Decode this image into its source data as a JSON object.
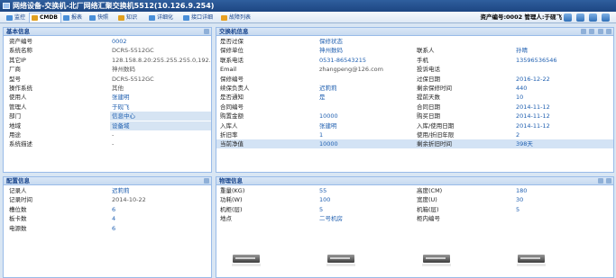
{
  "window": {
    "title": "网络设备-交换机-北厂网络汇聚交换机5512(10.126.9.254)"
  },
  "toolbar": {
    "tabs": [
      {
        "label": "监控",
        "color": "#4a8fd8",
        "active": false
      },
      {
        "label": "CMDB",
        "color": "#e0a020",
        "active": true
      },
      {
        "label": "报表",
        "color": "#4a8fd8",
        "active": false
      },
      {
        "label": "快照",
        "color": "#4a8fd8",
        "active": false
      },
      {
        "label": "知识",
        "color": "#e0a020",
        "active": false
      },
      {
        "label": "详细化",
        "color": "#4a8fd8",
        "active": false
      },
      {
        "label": "接口详细",
        "color": "#4a8fd8",
        "active": false
      },
      {
        "label": "故障列表",
        "color": "#e8a020",
        "active": false
      }
    ],
    "asset_info": "资产编号:0002  管理人:于砚飞",
    "tool_icons": [
      "refresh-icon",
      "home-icon",
      "print-icon",
      "export-icon"
    ]
  },
  "basic_info": {
    "title": "基本信息",
    "rows": [
      {
        "label": "资产编号",
        "value": "0002",
        "style": "link"
      },
      {
        "label": "系统名称",
        "value": "DCRS-5512GC",
        "style": ""
      },
      {
        "label": "其它IP",
        "value": "128.158.8.20:255.255.255.0,192.168.2...",
        "style": ""
      },
      {
        "label": "厂商",
        "value": "神州数码",
        "style": ""
      },
      {
        "label": "型号",
        "value": "DCRS-5512GC",
        "style": ""
      },
      {
        "label": "操作系统",
        "value": "其他",
        "style": ""
      },
      {
        "label": "使用人",
        "value": "张建明",
        "style": "link"
      },
      {
        "label": "管理人",
        "value": "于砚飞",
        "style": "link"
      },
      {
        "label": "部门",
        "value": "信息中心",
        "style": "sel"
      },
      {
        "label": "地域",
        "value": "设备域",
        "style": "sel"
      },
      {
        "label": "用途",
        "value": "-",
        "style": ""
      },
      {
        "label": "系统描述",
        "value": "-",
        "style": ""
      }
    ]
  },
  "config_info": {
    "title": "配置信息",
    "rows": [
      {
        "label": "记录人",
        "value": "迟莉莉",
        "style": "link"
      },
      {
        "label": "记录时间",
        "value": "2014-10-22",
        "style": ""
      },
      {
        "label": "槽位数",
        "value": "6",
        "style": "blue"
      },
      {
        "label": "板卡数",
        "value": "4",
        "style": "blue"
      },
      {
        "label": "电源数",
        "value": "6",
        "style": "blue"
      }
    ]
  },
  "switch_info": {
    "title": "交换机信息",
    "rows": [
      {
        "l1": "是否过保",
        "v1": "保修状态",
        "s1": "link",
        "l2": "",
        "v2": "",
        "s2": ""
      },
      {
        "l1": "保修单位",
        "v1": "神州数码",
        "s1": "link",
        "l2": "联系人",
        "v2": "孙晴",
        "s2": "link"
      },
      {
        "l1": "联系电话",
        "v1": "0531-86543215",
        "s1": "blue",
        "l2": "手机",
        "v2": "13596536546",
        "s2": "blue"
      },
      {
        "l1": "Email",
        "v1": "zhangpeng@126.com",
        "s1": "",
        "l2": "投诉电话",
        "v2": "",
        "s2": ""
      },
      {
        "l1": "保修编号",
        "v1": "",
        "s1": "",
        "l2": "过保日期",
        "v2": "2016-12-22",
        "s2": "blue"
      },
      {
        "l1": "续保负责人",
        "v1": "迟莉莉",
        "s1": "link",
        "l2": "剩余保修时间",
        "v2": "440",
        "s2": "blue"
      },
      {
        "l1": "是否通知",
        "v1": "是",
        "s1": "blue",
        "l2": "提前天数",
        "v2": "10",
        "s2": "blue"
      },
      {
        "l1": "合同编号",
        "v1": "",
        "s1": "",
        "l2": "合同日期",
        "v2": "2014-11-12",
        "s2": "blue"
      },
      {
        "l1": "购置金额",
        "v1": "10000",
        "s1": "blue",
        "l2": "购买日期",
        "v2": "2014-11-12",
        "s2": "blue"
      },
      {
        "l1": "入库人",
        "v1": "张建明",
        "s1": "link",
        "l2": "入库/使用日期",
        "v2": "2014-11-12",
        "s2": "blue"
      },
      {
        "l1": "折旧率",
        "v1": "1",
        "s1": "blue",
        "l2": "使用/折旧年限",
        "v2": "2",
        "s2": "blue"
      },
      {
        "l1": "当前净值",
        "v1": "10000",
        "s1": "blue",
        "l2": "剩余折旧时间",
        "v2": "398天",
        "s2": "blue"
      }
    ]
  },
  "physical_info": {
    "title": "物理信息",
    "rows": [
      {
        "l1": "重量(KG)",
        "v1": "55",
        "l2": "高度(CM)",
        "v2": "180"
      },
      {
        "l1": "功耗(W)",
        "v1": "100",
        "l2": "宽度(U)",
        "v2": "30"
      },
      {
        "l1": "机柜(层)",
        "v1": "5",
        "l2": "机箱(层)",
        "v2": "5"
      },
      {
        "l1": "地点",
        "v1": "二号机房",
        "l2": "柜内编号",
        "v2": ""
      }
    ],
    "thumbnails": [
      "device-front-image",
      "device-side-image",
      "device-top-image",
      "device-rear-image"
    ]
  }
}
